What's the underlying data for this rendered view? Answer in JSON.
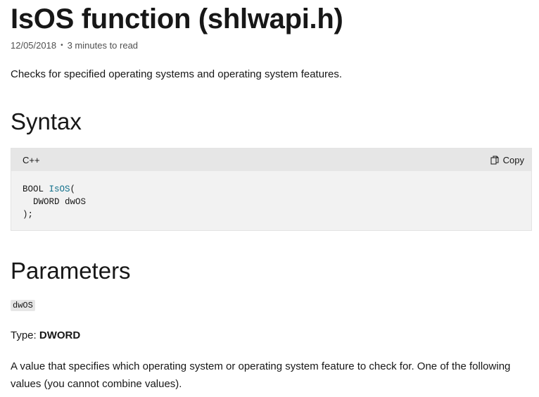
{
  "title": "IsOS function (shlwapi.h)",
  "meta": {
    "date": "12/05/2018",
    "separator": "•",
    "read_time": "3 minutes to read"
  },
  "summary": "Checks for specified operating systems and operating system features.",
  "syntax": {
    "heading": "Syntax",
    "language": "C++",
    "copy_label": "Copy",
    "code": {
      "line1_prefix": "BOOL ",
      "line1_fn": "IsOS",
      "line1_suffix": "(",
      "line2": "  DWORD dwOS",
      "line3": ");"
    }
  },
  "parameters": {
    "heading": "Parameters",
    "param_name": "dwOS",
    "type_label": "Type: ",
    "type_value": "DWORD",
    "description": "A value that specifies which operating system or operating system feature to check for. One of the following values (you cannot combine values)."
  },
  "icons": {
    "copy": "copy-icon"
  }
}
